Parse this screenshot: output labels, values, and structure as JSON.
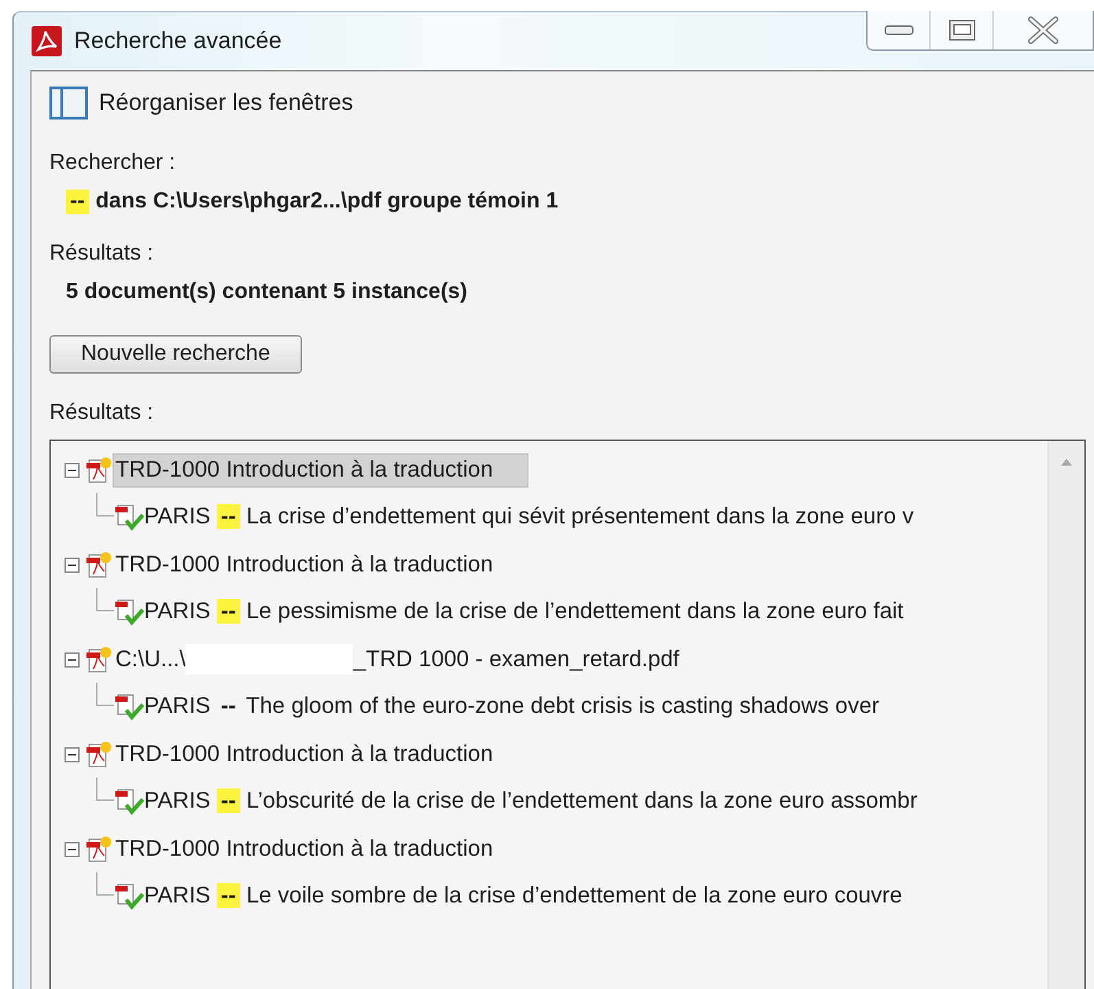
{
  "window": {
    "title": "Recherche avancée"
  },
  "toolbar": {
    "label": "Réorganiser les fenêtres"
  },
  "search": {
    "label": "Rechercher :",
    "highlight": "--",
    "query": "dans C:\\Users\\phgar2...\\pdf groupe témoin 1"
  },
  "summary": {
    "label": "Résultats :",
    "text": "5 document(s) contenant 5 instance(s)"
  },
  "new_search_button": "Nouvelle recherche",
  "results": {
    "label": "Résultats :",
    "documents": [
      {
        "label": "TRD-1000 Introduction à la traduction",
        "selected": true,
        "expanded": true,
        "children": [
          {
            "prefix": "PARIS",
            "mark": "--",
            "highlighted": true,
            "text": "La crise d’endettement qui sévit présentement dans la zone euro v"
          }
        ]
      },
      {
        "label": "TRD-1000 Introduction à la traduction",
        "selected": false,
        "expanded": true,
        "children": [
          {
            "prefix": "PARIS",
            "mark": "--",
            "highlighted": true,
            "text": "Le pessimisme de la crise de l’endettement dans la zone euro fait"
          }
        ]
      },
      {
        "label": "C:\\U...\\",
        "label_after_redaction": "_TRD 1000 - examen_retard.pdf",
        "selected": false,
        "expanded": true,
        "children": [
          {
            "prefix": "PARIS",
            "mark": "--",
            "highlighted": false,
            "text": "The gloom of the euro-zone debt crisis is casting shadows over"
          }
        ]
      },
      {
        "label": "TRD-1000 Introduction à la traduction",
        "selected": false,
        "expanded": true,
        "children": [
          {
            "prefix": "PARIS",
            "mark": "--",
            "highlighted": true,
            "text": "L’obscurité de la crise de l’endettement dans la zone euro assombr"
          }
        ]
      },
      {
        "label": "TRD-1000 Introduction à la traduction",
        "selected": false,
        "expanded": true,
        "children": [
          {
            "prefix": "PARIS",
            "mark": "--",
            "highlighted": true,
            "text": "Le voile sombre de la crise d’endettement de la zone euro couvre"
          }
        ]
      }
    ]
  }
}
